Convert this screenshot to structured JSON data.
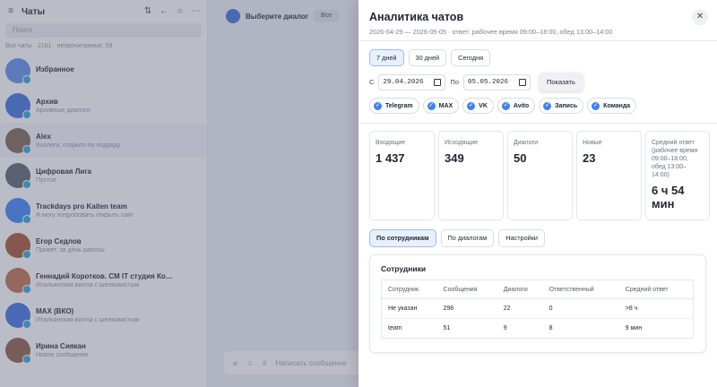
{
  "background": {
    "sidebar_title": "Чаты",
    "search_placeholder": "Поиск",
    "list_caption": "Все чаты · 2161 · непрочитанных: 59",
    "chats": [
      {
        "name": "Избранное",
        "preview": "",
        "time": "",
        "count": "",
        "color": "#5b8def"
      },
      {
        "name": "Архив",
        "preview": "Архивные диалоги",
        "time": "",
        "count": "",
        "color": "#3b6fe0"
      },
      {
        "name": "Alex",
        "preview": "Коллега, открыто по подряду",
        "time": "",
        "count": "",
        "color": "#7a6250"
      },
      {
        "name": "Цифровая Лига",
        "preview": "Пустое",
        "time": "",
        "count": "",
        "color": "#5b5f6b"
      },
      {
        "name": "Trackdays pro Kaiten team",
        "preview": "Я могу попробовать открыть сайт",
        "time": "",
        "count": "",
        "color": "#3b82f6"
      },
      {
        "name": "Егор Седлов",
        "preview": "Привет, за день работы",
        "time": "",
        "count": "",
        "color": "#a0522d"
      },
      {
        "name": "Геннадий Коротков. CM IT студия Коротков",
        "preview": "Итальянская вилла с шелковистым",
        "time": "",
        "count": "",
        "color": "#c06b4a"
      },
      {
        "name": "MAX (ВКО)",
        "preview": "Итальянская вилла с шелковистым",
        "time": "",
        "count": "",
        "color": "#3b6fe0"
      },
      {
        "name": "Ирина Сиякан",
        "preview": "Новое сообщение",
        "time": "",
        "count": "",
        "color": "#8a5a44"
      }
    ],
    "dialog_title": "Выберите диалог",
    "seg_label": "Все",
    "composer_placeholder": "Написать сообщение"
  },
  "panel": {
    "title": "Аналитика чатов",
    "subtitle": "2026-04-29 — 2026-05-05 · ответ: рабочее время 09:00–18:00, обед 13:00–14:00",
    "period_buttons": [
      "7 дней",
      "30 дней",
      "Сегодня"
    ],
    "from_label": "С",
    "from_date": "29.04.2026",
    "to_label": "По",
    "to_date": "05.05.2026",
    "show_button": "Показать",
    "sources": [
      "Telegram",
      "MAX",
      "VK",
      "Avito",
      "Запись",
      "Команда"
    ],
    "stats": [
      {
        "label": "Входящие",
        "value": "1 437"
      },
      {
        "label": "Исходящие",
        "value": "349"
      },
      {
        "label": "Диалоги",
        "value": "50"
      },
      {
        "label": "Новые",
        "value": "23"
      },
      {
        "label": "Средний ответ (рабочее время 09:00–18:00, обед 13:00–14:00)",
        "value": "6 ч 54 мин"
      }
    ],
    "tabs": [
      "По сотрудникам",
      "По диалогам",
      "Настройки"
    ],
    "employees_title": "Сотрудники",
    "table": {
      "headers": [
        "Сотрудник",
        "Сообщения",
        "Диалоги",
        "Ответственный",
        "Средний ответ"
      ],
      "rows": [
        [
          "Не указан",
          "298",
          "22",
          "0",
          ">8 ч"
        ],
        [
          "team",
          "51",
          "9",
          "8",
          "9 мин"
        ]
      ]
    },
    "accent_color": "#3b82f6"
  }
}
